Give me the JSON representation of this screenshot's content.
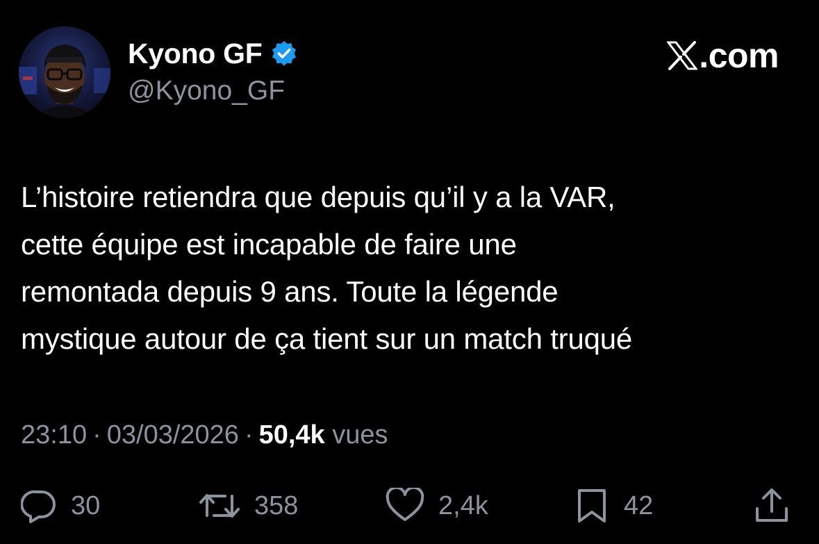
{
  "author": {
    "display_name": "Kyono GF",
    "handle": "@Kyono_GF",
    "verified": true
  },
  "brand": {
    "label": ".com",
    "logo_icon": "x-logo-icon"
  },
  "tweet": {
    "lines": [
      "L’histoire retiendra que depuis qu’il y a la VAR,",
      "cette équipe est incapable de faire une",
      "remontada depuis 9 ans. Toute la légende",
      "mystique autour de ça tient sur un match truqué"
    ]
  },
  "meta": {
    "time": "23:10",
    "date": "03/03/2026",
    "separator": "·",
    "views_count": "50,4k",
    "views_label": "vues"
  },
  "actions": {
    "reply": {
      "icon": "reply-icon",
      "count": "30"
    },
    "retweet": {
      "icon": "retweet-icon",
      "count": "358"
    },
    "like": {
      "icon": "heart-icon",
      "count": "2,4k"
    },
    "bookmark": {
      "icon": "bookmark-icon",
      "count": "42"
    },
    "share": {
      "icon": "share-icon"
    }
  },
  "colors": {
    "background": "#000000",
    "text": "#ffffff",
    "muted": "#8b949e",
    "verified": "#1d9bf0"
  }
}
